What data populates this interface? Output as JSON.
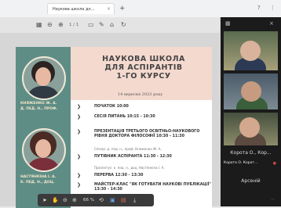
{
  "browser": {
    "tab_title": "Наукова школа дл...",
    "close_glyph": "×",
    "new_tab_glyph": "+",
    "controls": [
      "?",
      "⋮"
    ]
  },
  "viewer_toolbar": {
    "page_indicator": "1 / 1",
    "icons": [
      "grid-icon",
      "zoom-out-icon",
      "zoom-in-icon",
      "chat-icon",
      "annotate-icon",
      "rotate-icon"
    ]
  },
  "slide": {
    "title_line1": "НАУКОВА ШКОЛА",
    "title_line2": "ДЛЯ АСПІРАНТІВ",
    "title_line3": "1-ГО КУРСУ",
    "date": "14 вересня 2023 року",
    "speaker1_line1": "КНЯЖЕНКО Ж. А.",
    "speaker1_line2": "Д. ПЕД. Н., ПРОФ.",
    "speaker2_line1": "НАСТЯНКІНА І. А.",
    "speaker2_line2": "К. ПЕД. Н., ДОЦ.",
    "agenda": [
      {
        "text": "ПОЧАТОК 10:00",
        "note": ""
      },
      {
        "text": "СЕСІЯ ПИТАНЬ 10:15 - 10:30",
        "note": ""
      },
      {
        "text": "ПРЕЗЕНТАЦІЯ ТРЕТЬОГО ОСВІТНЬО-НАУКОВОГО РІВНЯ ДОКТОРА ФІЛОСОФІЇ 10:30 - 11:30",
        "note": "Спікер: д. пед. н., проф. Княженко Ж. А."
      },
      {
        "text": "ПУТІВНИК АСПІРАНТА 11:30 - 12:30",
        "note": "Презентує: к. пед. н., доц. Настянкіна І. А."
      },
      {
        "text": "ПЕРЕРВА 12:30 - 13:30",
        "note": ""
      },
      {
        "text": "МАЙСТЕР-КЛАС \"ЯК ГОТУВАТИ НАУКОВІ ПУБЛІКАЦІЇ\" 13:30 - 14:30",
        "note": ""
      }
    ]
  },
  "pdf_toolbar": {
    "zoom": "66 %",
    "icons": [
      "cursor-icon",
      "hand-icon",
      "zoom-out-icon",
      "zoom-in-icon",
      "fit-icon",
      "word-icon",
      "pdf-icon",
      "download-icon"
    ]
  },
  "video": {
    "participant_caption": "Корота О., Кор...",
    "small_caption": "Корота О. Корот...",
    "bottom_name": "Арсеній",
    "accent": "#c44a4a"
  }
}
